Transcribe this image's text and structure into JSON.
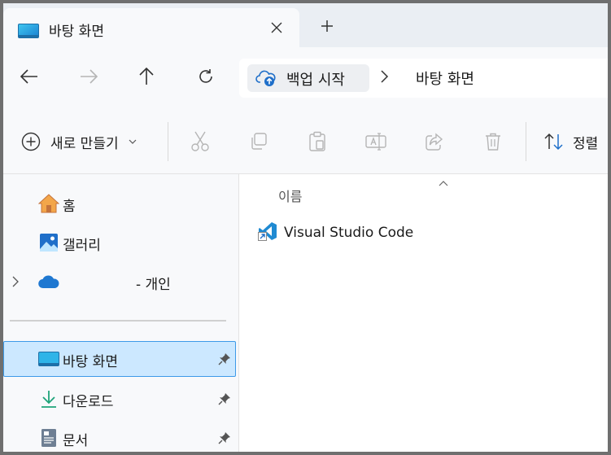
{
  "tab": {
    "title": "바탕 화면"
  },
  "address": {
    "backup_label": "백업 시작",
    "current_location": "바탕 화면"
  },
  "toolbar": {
    "new_label": "새로 만들기",
    "sort_label": "정렬"
  },
  "nav": {
    "items": [
      {
        "label": "홈",
        "icon": "home-icon"
      },
      {
        "label": "갤러리",
        "icon": "gallery-icon"
      },
      {
        "label": "- 개인",
        "icon": "onedrive-cloud-icon"
      },
      {
        "label": "바탕 화면",
        "icon": "desktop-folder-icon",
        "selected": true
      },
      {
        "label": "다운로드",
        "icon": "download-icon"
      },
      {
        "label": "문서",
        "icon": "documents-icon"
      }
    ]
  },
  "content": {
    "column_name": "이름",
    "files": [
      {
        "name": "Visual Studio Code",
        "icon": "vscode-shortcut-icon"
      }
    ]
  },
  "colors": {
    "accent": "#3d9ae8",
    "selection": "#cce8ff",
    "chrome": "#f8f9fb",
    "tabstrip": "#eaeef3"
  }
}
